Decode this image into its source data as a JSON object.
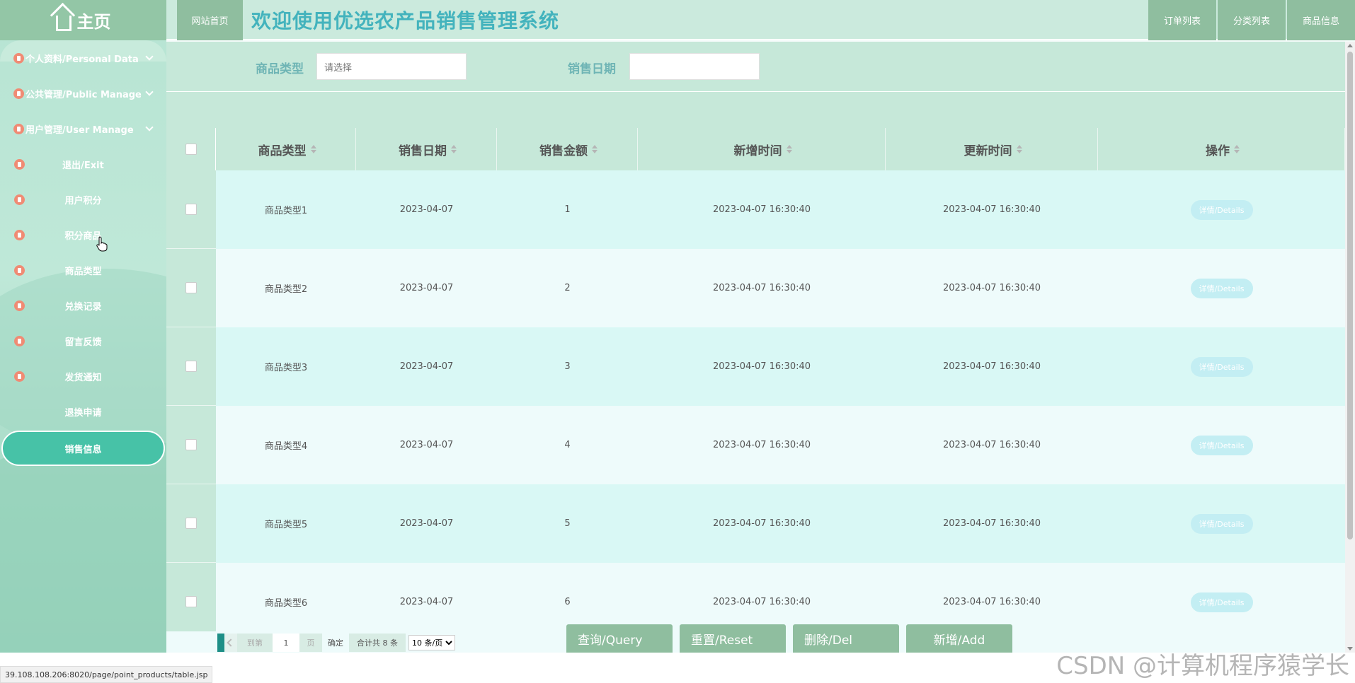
{
  "sidebar": {
    "home_label": "主页",
    "groups": [
      {
        "label": "个人资料/Personal Data"
      },
      {
        "label": "公共管理/Public Manage"
      },
      {
        "label": "用户管理/User Manage"
      }
    ],
    "items": [
      {
        "label": "退出/Exit"
      },
      {
        "label": "用户积分"
      },
      {
        "label": "积分商品"
      },
      {
        "label": "商品类型"
      },
      {
        "label": "兑换记录"
      },
      {
        "label": "留言反馈"
      },
      {
        "label": "发货通知"
      },
      {
        "label": "退换申请"
      }
    ],
    "active_item": "销售信息"
  },
  "header": {
    "home_button": "网站首页",
    "title": "欢迎使用优选农产品销售管理系统",
    "right_buttons": [
      "订单列表",
      "分类列表",
      "商品信息"
    ]
  },
  "search": {
    "type_label": "商品类型",
    "type_placeholder": "请选择",
    "date_label": "销售日期",
    "date_value": ""
  },
  "table": {
    "columns": [
      "商品类型",
      "销售日期",
      "销售金额",
      "新增时间",
      "更新时间",
      "操作"
    ],
    "rows": [
      {
        "type": "商品类型1",
        "date": "2023-04-07",
        "amount": "1",
        "created": "2023-04-07 16:30:40",
        "updated": "2023-04-07 16:30:40",
        "action": "详情/Details"
      },
      {
        "type": "商品类型2",
        "date": "2023-04-07",
        "amount": "2",
        "created": "2023-04-07 16:30:40",
        "updated": "2023-04-07 16:30:40",
        "action": "详情/Details"
      },
      {
        "type": "商品类型3",
        "date": "2023-04-07",
        "amount": "3",
        "created": "2023-04-07 16:30:40",
        "updated": "2023-04-07 16:30:40",
        "action": "详情/Details"
      },
      {
        "type": "商品类型4",
        "date": "2023-04-07",
        "amount": "4",
        "created": "2023-04-07 16:30:40",
        "updated": "2023-04-07 16:30:40",
        "action": "详情/Details"
      },
      {
        "type": "商品类型5",
        "date": "2023-04-07",
        "amount": "5",
        "created": "2023-04-07 16:30:40",
        "updated": "2023-04-07 16:30:40",
        "action": "详情/Details"
      },
      {
        "type": "商品类型6",
        "date": "2023-04-07",
        "amount": "6",
        "created": "2023-04-07 16:30:40",
        "updated": "2023-04-07 16:30:40",
        "action": "详情/Details"
      }
    ]
  },
  "pager": {
    "goto_label": "到第",
    "page_value": "1",
    "page_unit": "页",
    "confirm": "确定",
    "total": "合计共 8 条",
    "page_size": "10 条/页"
  },
  "actions": {
    "query": "查询/Query",
    "reset": "重置/Reset",
    "delete": "删除/Del",
    "add": "新增/Add"
  },
  "status_url": "39.108.108.206:8020/page/point_products/table.jsp",
  "watermark": "CSDN @计算机程序猿学长",
  "colors": {
    "accent": "#47c2a7",
    "title": "#43b3bd",
    "button": "#8fbe9f",
    "icon": "#f08b74"
  }
}
